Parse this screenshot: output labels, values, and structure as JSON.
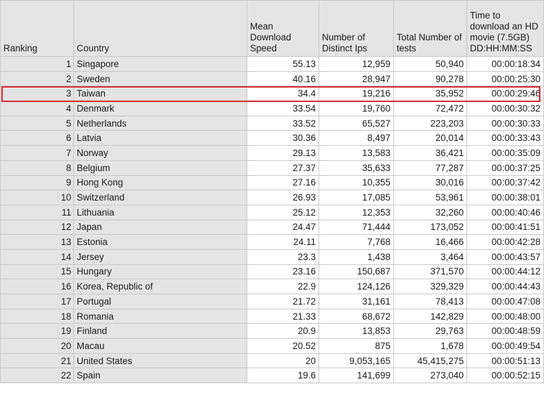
{
  "table": {
    "columns": [
      "Ranking",
      "Country",
      "Mean Download Speed",
      "Number of Distinct Ips",
      "Total Number of tests",
      "Time to download an HD movie (7.5GB) DD:HH:MM:SS"
    ],
    "rows": [
      [
        "1",
        "Singapore",
        "55.13",
        "12,959",
        "50,940",
        "00:00:18:34"
      ],
      [
        "2",
        "Sweden",
        "40.16",
        "28,947",
        "90,278",
        "00:00:25:30"
      ],
      [
        "3",
        "Taiwan",
        "34.4",
        "19,216",
        "35,952",
        "00:00:29:46"
      ],
      [
        "4",
        "Denmark",
        "33.54",
        "19,760",
        "72,472",
        "00:00:30:32"
      ],
      [
        "5",
        "Netherlands",
        "33.52",
        "65,527",
        "223,203",
        "00:00:30:33"
      ],
      [
        "6",
        "Latvia",
        "30.36",
        "8,497",
        "20,014",
        "00:00:33:43"
      ],
      [
        "7",
        "Norway",
        "29.13",
        "13,583",
        "36,421",
        "00:00:35:09"
      ],
      [
        "8",
        "Belgium",
        "27.37",
        "35,633",
        "77,287",
        "00:00:37:25"
      ],
      [
        "9",
        "Hong Kong",
        "27.16",
        "10,355",
        "30,016",
        "00:00:37:42"
      ],
      [
        "10",
        "Switzerland",
        "26.93",
        "17,085",
        "53,961",
        "00:00:38:01"
      ],
      [
        "11",
        "Lithuania",
        "25.12",
        "12,353",
        "32,260",
        "00:00:40:46"
      ],
      [
        "12",
        "Japan",
        "24.47",
        "71,444",
        "173,052",
        "00:00:41:51"
      ],
      [
        "13",
        "Estonia",
        "24.11",
        "7,768",
        "16,466",
        "00:00:42:28"
      ],
      [
        "14",
        "Jersey",
        "23.3",
        "1,438",
        "3,464",
        "00:00:43:57"
      ],
      [
        "15",
        "Hungary",
        "23.16",
        "150,687",
        "371,570",
        "00:00:44:12"
      ],
      [
        "16",
        "Korea, Republic of",
        "22.9",
        "124,126",
        "329,329",
        "00:00:44:43"
      ],
      [
        "17",
        "Portugal",
        "21.72",
        "31,161",
        "78,413",
        "00:00:47:08"
      ],
      [
        "18",
        "Romania",
        "21.33",
        "68,672",
        "142,829",
        "00:00:48:00"
      ],
      [
        "19",
        "Finland",
        "20.9",
        "13,853",
        "29,763",
        "00:00:48:59"
      ],
      [
        "20",
        "Macau",
        "20.52",
        "875",
        "1,678",
        "00:00:49:54"
      ],
      [
        "21",
        "United States",
        "20",
        "9,053,165",
        "45,415,275",
        "00:00:51:13"
      ],
      [
        "22",
        "Spain",
        "19.6",
        "141,699",
        "273,040",
        "00:00:52:15"
      ]
    ],
    "highlighted_row": "3"
  },
  "colors": {
    "header_bg": "#e4e4e4",
    "highlight_border": "#d9272e",
    "grid_line": "#c8c8c8"
  }
}
